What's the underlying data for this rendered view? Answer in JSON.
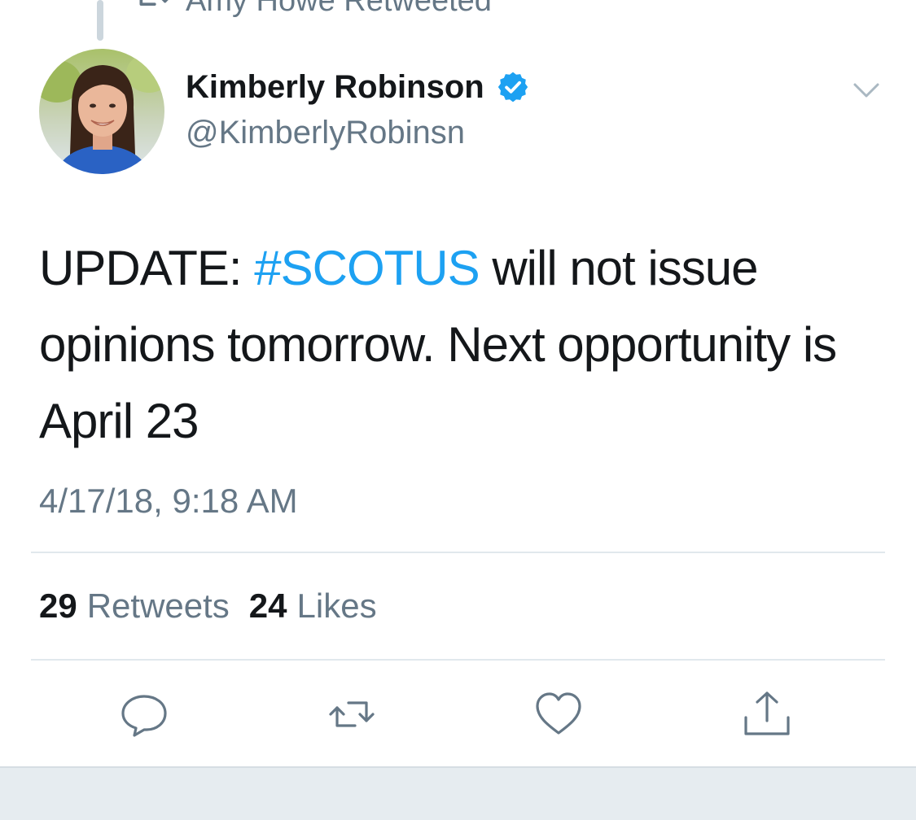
{
  "retweet_context": {
    "icon": "retweet-icon",
    "text": "Amy Howe Retweeted"
  },
  "author": {
    "display_name": "Kimberly Robinson",
    "handle": "@KimberlyRobinsn",
    "verified": true,
    "verified_icon": "verified-badge-icon"
  },
  "tweet": {
    "text_before": "UPDATE: ",
    "hashtag": "#SCOTUS",
    "text_after": " will not issue opinions tomorrow. Next opportunity is April 23",
    "timestamp": "4/17/18, 9:18 AM"
  },
  "stats": {
    "retweets_count": "29",
    "retweets_label": "Retweets",
    "likes_count": "24",
    "likes_label": "Likes"
  },
  "actions": [
    {
      "name": "reply",
      "icon": "reply-icon"
    },
    {
      "name": "retweet",
      "icon": "retweet-icon"
    },
    {
      "name": "like",
      "icon": "heart-icon"
    },
    {
      "name": "share",
      "icon": "share-icon"
    }
  ],
  "colors": {
    "accent": "#1da1f2",
    "text_primary": "#14171a",
    "text_secondary": "#657786",
    "divider": "#e1e8ed",
    "bottom_bar": "#e6ecf0"
  }
}
